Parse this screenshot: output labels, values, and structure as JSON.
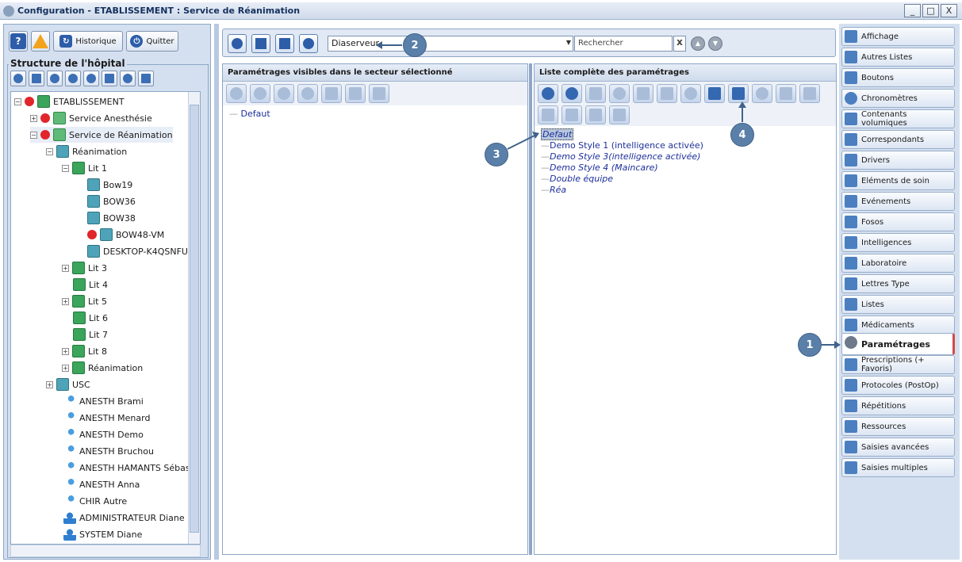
{
  "window": {
    "title": "Configuration - ETABLISSEMENT : Service de Réanimation",
    "controls": [
      "_",
      "□",
      "X"
    ]
  },
  "left": {
    "historique_label": "Historique",
    "quitter_label": "Quitter",
    "structure_label": "Structure de l'hôpital",
    "tree": [
      {
        "label": "ETABLISSEMENT"
      },
      {
        "label": "Service Anesthésie"
      },
      {
        "label": "Service de Réanimation"
      },
      {
        "label": "Réanimation"
      },
      {
        "label": "Lit 1"
      },
      {
        "label": "Bow19"
      },
      {
        "label": "BOW36"
      },
      {
        "label": "BOW38"
      },
      {
        "label": "BOW48-VM"
      },
      {
        "label": "DESKTOP-K4QSNFU"
      },
      {
        "label": "Lit 3"
      },
      {
        "label": "Lit 4"
      },
      {
        "label": "Lit 5"
      },
      {
        "label": "Lit 6"
      },
      {
        "label": "Lit 7"
      },
      {
        "label": "Lit 8"
      },
      {
        "label": "Réanimation"
      },
      {
        "label": "USC"
      },
      {
        "label": "ANESTH Brami"
      },
      {
        "label": "ANESTH Menard"
      },
      {
        "label": "ANESTH Demo"
      },
      {
        "label": "ANESTH Bruchou"
      },
      {
        "label": "ANESTH HAMANTS Sébastien"
      },
      {
        "label": "ANESTH Anna"
      },
      {
        "label": "CHIR Autre"
      },
      {
        "label": "ADMINISTRATEUR Diane"
      },
      {
        "label": "SYSTEM Diane"
      }
    ]
  },
  "toolbar": {
    "dropdown_value": "Diaserveur",
    "search_placeholder": "Rechercher",
    "clear_label": "x"
  },
  "panel_left": {
    "title": "Paramétrages visibles dans le secteur sélectionné",
    "items": [
      "Defaut"
    ]
  },
  "panel_right": {
    "title": "Liste complète des paramétrages",
    "items": [
      "Defaut",
      "Demo Style 1 (intelligence activée)",
      "Demo Style 3(intelligence activée)",
      "Demo Style 4 (Maincare)",
      "Double équipe",
      "Réa"
    ]
  },
  "sidebar": {
    "items": [
      "Affichage",
      "Autres Listes",
      "Boutons",
      "Chronomètres",
      "Contenants volumiques",
      "Correspondants",
      "Drivers",
      "Eléments de soin",
      "Evénements",
      "Fosos",
      "Intelligences",
      "Laboratoire",
      "Lettres Type",
      "Listes",
      "Médicaments",
      "Paramétrages",
      "Prescriptions (+ Favoris)",
      "Protocoles (PostOp)",
      "Répétitions",
      "Ressources",
      "Saisies avancées",
      "Saisies multiples"
    ],
    "active": "Paramétrages"
  },
  "callouts": [
    "1",
    "2",
    "3",
    "4"
  ],
  "colors": {
    "accent": "#3468b0",
    "callout": "#5a7fa8",
    "active_marker": "#d04a4a",
    "list_text": "#1c2f9a"
  }
}
